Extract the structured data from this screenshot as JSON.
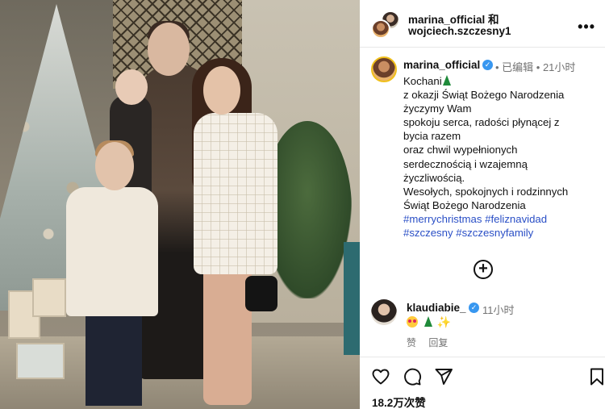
{
  "post": {
    "author_line1": "marina_official 和",
    "author_line2": "wojciech.szczesny1",
    "more_label": "•••"
  },
  "caption": {
    "username": "marina_official",
    "verified_mark": "✓",
    "meta": "• 已编辑 • 21小时",
    "lines": [
      "Kochani",
      "z okazji Świąt Bożego Narodzenia",
      "życzymy Wam",
      "spokoju serca, radości płynącej z",
      "bycia razem",
      "oraz chwil wypełnionych",
      "serdecznością i wzajemną",
      "życzliwością.",
      "Wesołych, spokojnych i rodzinnych",
      "Świąt Bożego Narodzenia"
    ],
    "hashtags_line1": [
      "#merrychristmas",
      "#feliznavidad"
    ],
    "hashtags_line2": [
      "#szczesny",
      "#szczesnyfamily"
    ]
  },
  "add_comment_icon": "plus-circle-icon",
  "comment": {
    "username": "klaudiabie_",
    "verified_mark": "✓",
    "time": "11小时",
    "sparkles": "✨",
    "like_label": "赞",
    "reply_label": "回复"
  },
  "actions": {
    "icons": [
      "heart-icon",
      "comment-icon",
      "share-icon",
      "bookmark-icon"
    ],
    "likes_text": "18.2万次赞"
  },
  "colors": {
    "hashtag": "#2a4fc6",
    "verified": "#3897f0",
    "muted": "#737373"
  }
}
